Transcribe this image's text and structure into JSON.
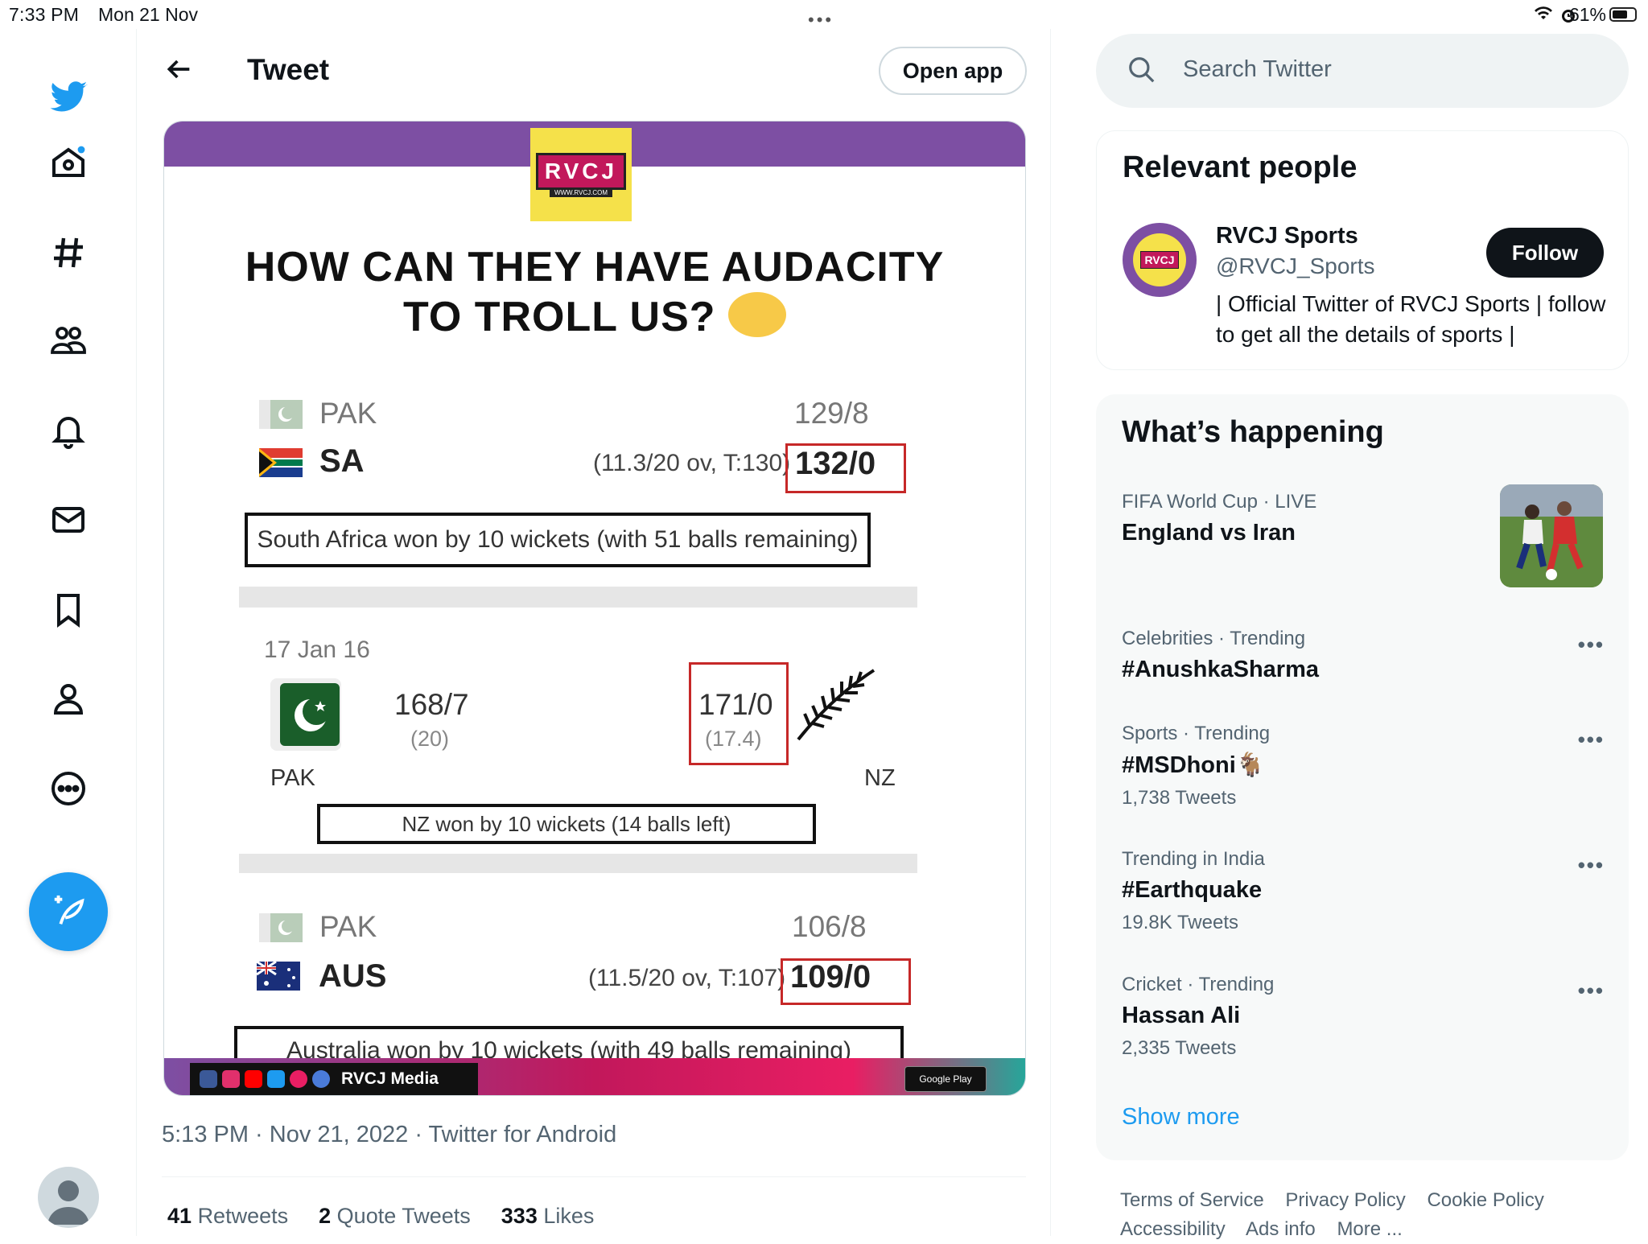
{
  "status_bar": {
    "time": "7:33 PM",
    "date": "Mon 21 Nov",
    "dots": "•••",
    "battery": "61%"
  },
  "header": {
    "title": "Tweet",
    "open_app": "Open app"
  },
  "media": {
    "brand": "RVCJ",
    "brand_url": "WWW.RVCJ.COM",
    "headline_line1": "HOW CAN THEY HAVE AUDACITY",
    "headline_line2": "TO TROLL US?",
    "match1": {
      "team1": "PAK",
      "score1": "129/8",
      "team2": "SA",
      "detail": "(11.3/20 ov, T:130)",
      "score2": "132/0",
      "result": "South Africa won by 10 wickets (with 51 balls remaining)"
    },
    "match2": {
      "date": "17 Jan 16",
      "team1": "PAK",
      "score1": "168/7",
      "overs1": "(20)",
      "team2": "NZ",
      "score2": "171/0",
      "overs2": "(17.4)",
      "result": "NZ won by 10 wickets (14 balls left)"
    },
    "match3": {
      "team1": "PAK",
      "score1": "106/8",
      "team2": "AUS",
      "detail": "(11.5/20 ov, T:107)",
      "score2": "109/0",
      "result": "Australia won by 10 wickets (with 49 balls remaining)"
    },
    "footer_brand": "RVCJ Media",
    "google_play": "Google Play"
  },
  "tweet_meta": "5:13 PM · Nov 21, 2022 · Twitter for Android",
  "stats": [
    {
      "count": "41",
      "label": "Retweets"
    },
    {
      "count": "2",
      "label": "Quote Tweets"
    },
    {
      "count": "333",
      "label": "Likes"
    }
  ],
  "search": {
    "placeholder": "Search Twitter"
  },
  "relevant_people": {
    "title": "Relevant people",
    "name": "RVCJ Sports",
    "handle": "@RVCJ_Sports",
    "bio": "| Official Twitter of RVCJ Sports | follow to get all the details of sports |",
    "follow": "Follow",
    "avatar_text": "RVCJ"
  },
  "whats_happening": {
    "title": "What’s happening",
    "trends": [
      {
        "context": "FIFA World Cup · LIVE",
        "title": "England vs Iran",
        "count": ""
      },
      {
        "context": "Celebrities · Trending",
        "title": "#AnushkaSharma",
        "count": ""
      },
      {
        "context": "Sports · Trending",
        "title": "#MSDhoni🐐",
        "count": "1,738 Tweets"
      },
      {
        "context": "Trending in India",
        "title": "#Earthquake",
        "count": "19.8K Tweets"
      },
      {
        "context": "Cricket · Trending",
        "title": "Hassan Ali",
        "count": "2,335 Tweets"
      }
    ],
    "show_more": "Show more"
  },
  "footer": {
    "links": [
      "Terms of Service",
      "Privacy Policy",
      "Cookie Policy",
      "Accessibility",
      "Ads info",
      "More ..."
    ]
  },
  "colors": {
    "accent": "#1d9bf0",
    "text": "#0f1419",
    "secondary": "#536471",
    "purple": "#7d4fa3",
    "red_box": "#c62828"
  }
}
